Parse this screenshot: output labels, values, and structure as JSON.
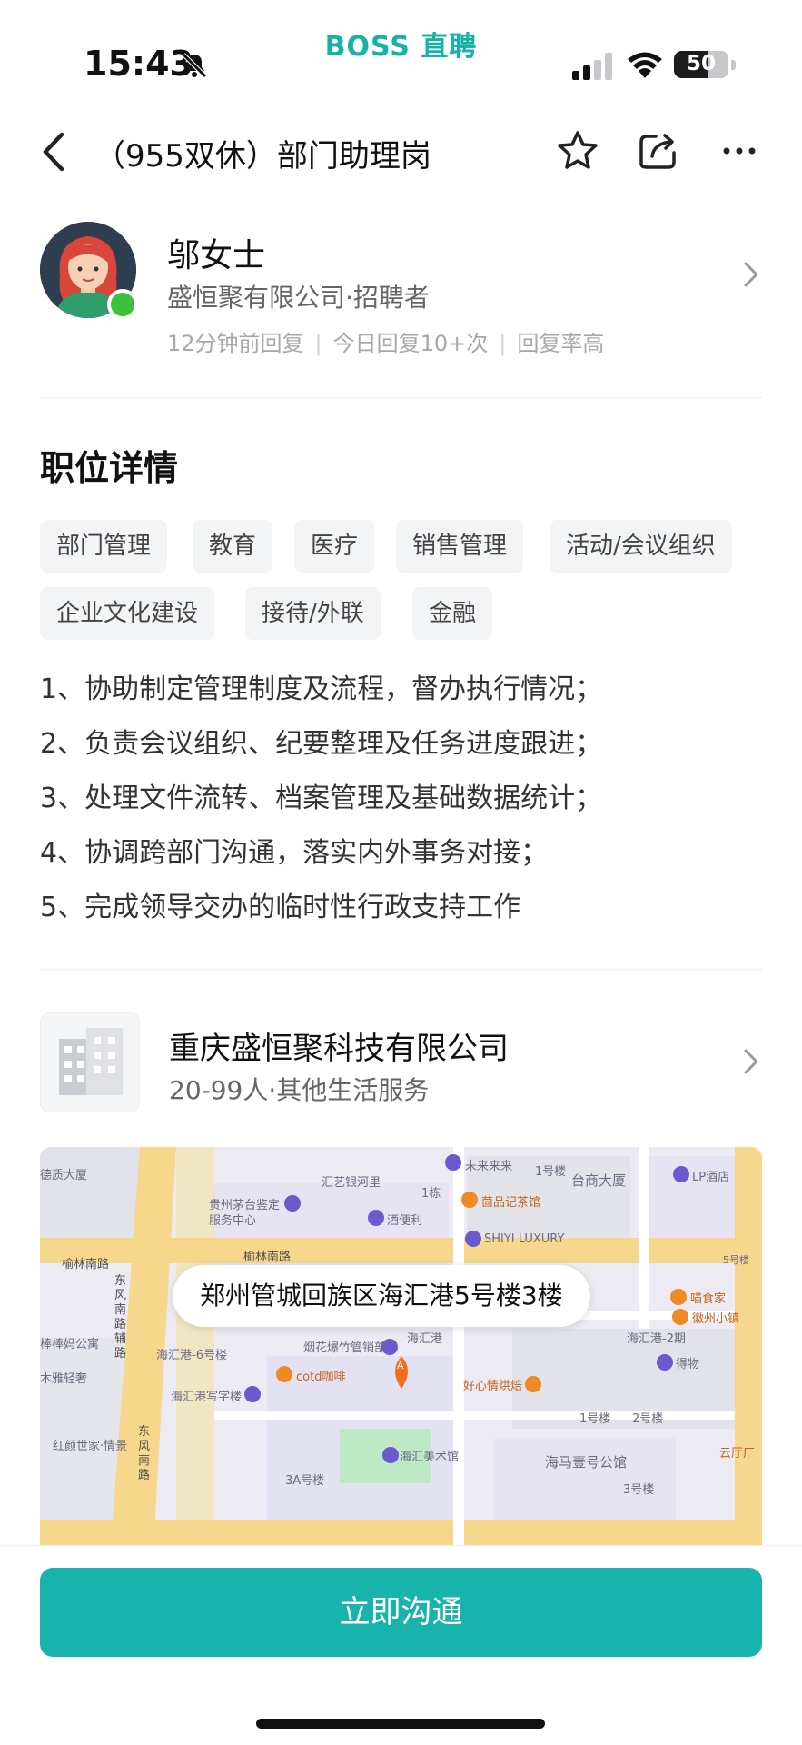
{
  "status_bar": {
    "brand": "BOSS 直聘",
    "time": "15:43",
    "battery": "50",
    "battery_level": 0.5
  },
  "nav": {
    "title": "（955双休）部门助理岗",
    "icons": [
      "back-icon",
      "star-icon",
      "share-icon",
      "more-icon"
    ]
  },
  "recruiter": {
    "name": "邬女士",
    "company_role": "盛恒聚有限公司·招聘者",
    "stats": [
      "12分钟前回复",
      "今日回复10+次",
      "回复率高"
    ]
  },
  "job": {
    "section_title": "职位详情",
    "tags": [
      "部门管理",
      "教育",
      "医疗",
      "销售管理",
      "活动/会议组织",
      "企业文化建设",
      "接待/外联",
      "金融"
    ],
    "description": [
      "1、协助制定管理制度及流程，督办执行情况；",
      "2、负责会议组织、纪要整理及任务进度跟进；",
      "3、处理文件流转、档案管理及基础数据统计；",
      "4、协调跨部门沟通，落实内外事务对接；",
      "5、完成领导交办的临时性行政支持工作"
    ]
  },
  "company": {
    "name": "重庆盛恒聚科技有限公司",
    "info": "20-99人·其他生活服务"
  },
  "map": {
    "address": "郑州管城回族区海汇港5号楼3楼",
    "labels": {
      "l1": "德质大厦",
      "l2": "汇艺银河里",
      "l3": "未来来来",
      "l4": "1号楼",
      "l5": "台商大厦",
      "l6": "LP酒店",
      "l7": "贵州茅台鉴定服务中心",
      "l8": "茴品记茶馆",
      "l9": "1栋",
      "l10": "酒便利",
      "l11": "SHIYI LUXURY",
      "l12": "榆林南路",
      "l13": "榆林南路",
      "l14": "东风南路辅路",
      "l15": "喵食家",
      "l16": "徽州小镇",
      "l17": "海汇港-2期",
      "l18": "得物",
      "l19": "烟花爆竹管销部",
      "l20": "海汇港",
      "l21": "海汇港-6号楼",
      "l22": "cotd咖啡",
      "l23": "棒棒妈公寓",
      "l24": "木雅轻奢",
      "l25": "海汇港写字楼",
      "l26": "好心情烘焙",
      "l27": "1号楼",
      "l28": "2号楼",
      "l29": "红颜世家·情景",
      "l30": "东风南路",
      "l31": "海汇美术馆",
      "l32": "海马壹号公馆",
      "l33": "3A号楼",
      "l34": "3号楼",
      "l35": "云厅厂",
      "l36": "5号楼",
      "l37": "A"
    }
  },
  "actions": {
    "chat": "立即沟通"
  }
}
